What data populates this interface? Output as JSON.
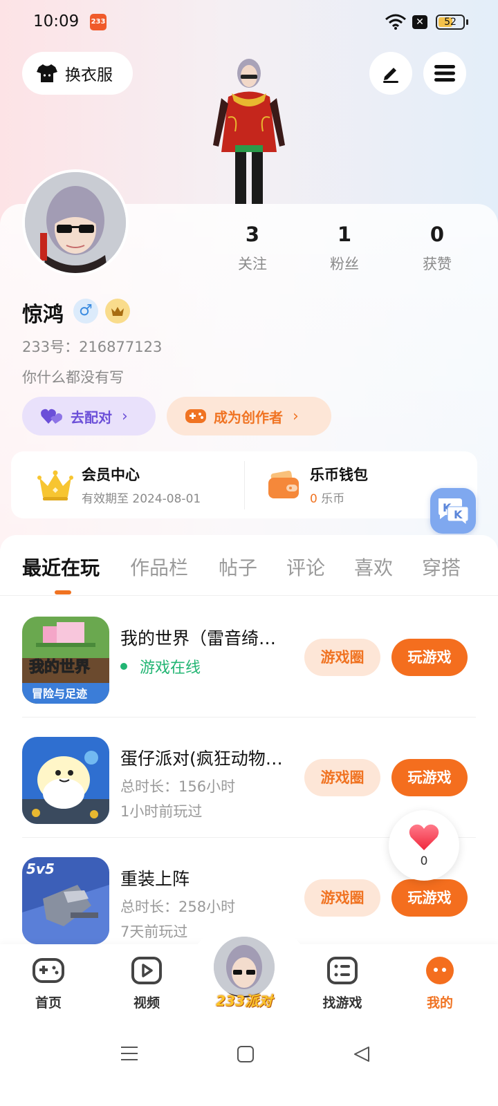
{
  "status_bar": {
    "time": "10:09",
    "battery": "52"
  },
  "header": {
    "outfit_label": "换衣服"
  },
  "profile": {
    "stats": [
      {
        "value": "3",
        "label": "关注"
      },
      {
        "value": "1",
        "label": "粉丝"
      },
      {
        "value": "0",
        "label": "获赞"
      }
    ],
    "name": "惊鸿",
    "gender_symbol": "♂",
    "uid": "233号：216877123",
    "bio": "你什么都没有写",
    "match_label": "去配对",
    "creator_label": "成为创作者"
  },
  "vip": {
    "member_title": "会员中心",
    "member_sub": "有效期至 2024-08-01",
    "wallet_title": "乐币钱包",
    "wallet_amount": "0",
    "wallet_unit": "乐币"
  },
  "tabs": [
    "最近在玩",
    "作品栏",
    "帖子",
    "评论",
    "喜欢",
    "穿搭"
  ],
  "games": [
    {
      "name": "我的世界（雷音绮…",
      "online": "游戏在线",
      "circle_label": "游戏圈",
      "play_label": "玩游戏"
    },
    {
      "name": "蛋仔派对(疯狂动物…",
      "duration": "总时长：156小时",
      "last_played": "1小时前玩过",
      "circle_label": "游戏圈",
      "play_label": "玩游戏"
    },
    {
      "name": "重装上阵",
      "duration": "总时长：258小时",
      "last_played": "7天前玩过",
      "circle_label": "游戏圈",
      "play_label": "玩游戏"
    }
  ],
  "game_icon_text": {
    "mc_title": "我的世界",
    "mc_sub": "冒险与足迹",
    "mech_badge": "5v5"
  },
  "like_count": "0",
  "bottom_nav": {
    "items": [
      "首页",
      "视频",
      "找游戏",
      "我的"
    ],
    "center_label": "233派对"
  },
  "colors": {
    "accent": "#f07322",
    "play_button": "#f46e1e",
    "online_green": "#22b573",
    "match_purple": "#6b4fd8"
  }
}
